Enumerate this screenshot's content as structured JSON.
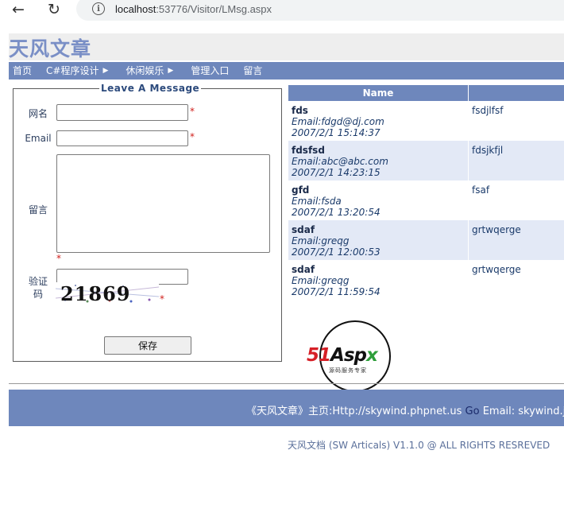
{
  "browser": {
    "url_host": "localhost",
    "url_rest": ":53776/Visitor/LMsg.aspx",
    "back_icon": "←",
    "reload_icon": "↻",
    "info_icon": "i"
  },
  "site": {
    "title": "天风文章"
  },
  "menu": [
    {
      "label": "首页",
      "has_arrow": false
    },
    {
      "label": "C#程序设计",
      "has_arrow": true
    },
    {
      "label": "休闲娱乐",
      "has_arrow": true
    },
    {
      "label": "管理入口",
      "has_arrow": false
    },
    {
      "label": "留言",
      "has_arrow": false
    }
  ],
  "form": {
    "legend": "Leave A Message",
    "name_label": "网名",
    "email_label": "Email",
    "message_label": "留言",
    "code_label": "验证码",
    "required_mark": "*",
    "captcha_text": "21869",
    "save_label": "保存"
  },
  "messages": {
    "header_name": "Name",
    "header_content": "",
    "rows": [
      {
        "name": "fds",
        "email": "Email:fdgd@dj.com",
        "time": "2007/2/1 15:14:37",
        "content": "fsdjlfsf"
      },
      {
        "name": "fdsfsd",
        "email": "Email:abc@abc.com",
        "time": "2007/2/1 14:23:15",
        "content": "fdsjkfjl"
      },
      {
        "name": "gfd",
        "email": "Email:fsda",
        "time": "2007/2/1 13:20:54",
        "content": "fsaf"
      },
      {
        "name": "sdaf",
        "email": "Email:greqg",
        "time": "2007/2/1 12:00:53",
        "content": "grtwqerge"
      },
      {
        "name": "sdaf",
        "email": "Email:greqg",
        "time": "2007/2/1 11:59:54",
        "content": "grtwqerge"
      }
    ]
  },
  "logo": {
    "text_51": "51",
    "text_asp": "Asp",
    "text_x": "x",
    "subtitle": "源码服务专家"
  },
  "footer": {
    "homepage_text": "《天风文章》主页:Http://skywind.phpnet.us",
    "go_text": "Go",
    "email_text": "Email: skywind.jin@gmail.com",
    "copyright": "天风文档 (SW Articals) V1.1.0 @ ALL RIGHTS RESREVED"
  }
}
